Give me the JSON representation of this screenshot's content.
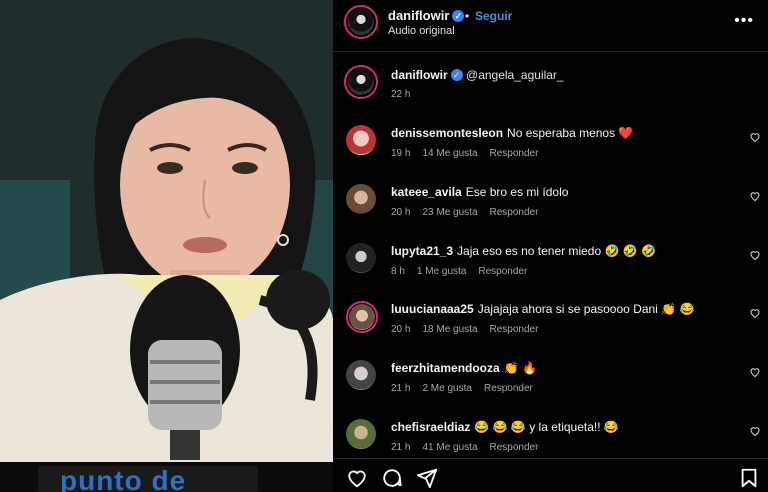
{
  "video": {
    "overlay_text": "punto de"
  },
  "header": {
    "username": "daniflowir",
    "separator": "•",
    "follow_label": "Seguir",
    "subtitle": "Audio original",
    "more_label": "•••"
  },
  "caption": {
    "username": "daniflowir",
    "text": "@angela_aguilar_",
    "time": "22 h"
  },
  "comments": [
    {
      "username": "denissemontesleon",
      "text": "No esperaba menos ❤️",
      "time": "19 h",
      "likes": "14 Me gusta",
      "reply": "Responder"
    },
    {
      "username": "kateee_avila",
      "text": "Ese bro es mi ídolo",
      "time": "20 h",
      "likes": "23 Me gusta",
      "reply": "Responder"
    },
    {
      "username": "lupyta21_3",
      "text": "Jaja eso es no tener miedo 🤣 🤣 🤣",
      "time": "8 h",
      "likes": "1 Me gusta",
      "reply": "Responder"
    },
    {
      "username": "luuucianaaa25",
      "text": "Jajajaja ahora si se pasoooo Dani 👏 😂",
      "time": "20 h",
      "likes": "18 Me gusta",
      "reply": "Responder"
    },
    {
      "username": "feerzhitamendooza",
      "text": "👏 🔥",
      "time": "21 h",
      "likes": "2 Me gusta",
      "reply": "Responder"
    },
    {
      "username": "chefisraeldiaz",
      "text": "😂 😂 😂 y la etiqueta!! 😂",
      "time": "21 h",
      "likes": "41 Me gusta",
      "reply": "Responder"
    }
  ],
  "icons": {
    "like": "heart-icon",
    "comment": "comment-icon",
    "share": "share-icon",
    "save": "bookmark-icon"
  },
  "colors": {
    "accent": "#4a90e2",
    "verified": "#3b82f6",
    "ring": "#d62976"
  }
}
